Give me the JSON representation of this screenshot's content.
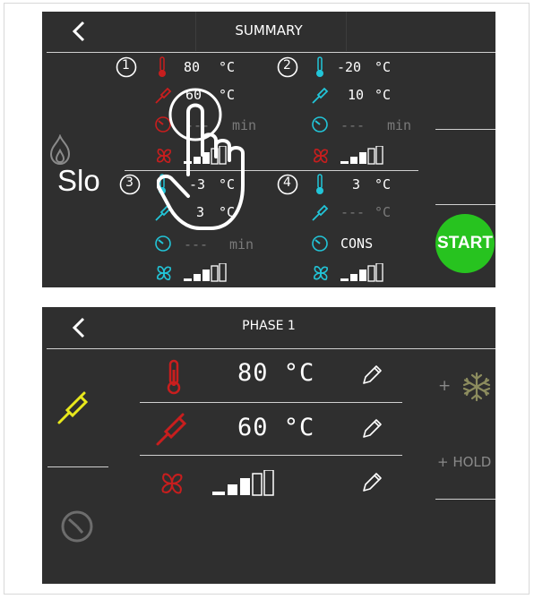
{
  "summary": {
    "title": "SUMMARY",
    "partial_text": "Slo",
    "start_label": "START",
    "phases": [
      {
        "num": "1",
        "temp": "80",
        "temp_unit": "°C",
        "probe": "60",
        "probe_unit": "°C",
        "time": "---",
        "time_unit": "min"
      },
      {
        "num": "2",
        "temp": "-20",
        "temp_unit": "°C",
        "probe": "10",
        "probe_unit": "°C",
        "time": "---",
        "time_unit": "min"
      },
      {
        "num": "3",
        "temp": "-3",
        "temp_unit": "°C",
        "probe": "3",
        "probe_unit": "°C",
        "time": "---",
        "time_unit": "min"
      },
      {
        "num": "4",
        "temp": "3",
        "temp_unit": "°C",
        "probe": "---",
        "probe_unit": "°C",
        "time": "CONS"
      }
    ],
    "overlay_icon": "tap-hand-icon"
  },
  "phase": {
    "title": "PHASE 1",
    "temp": "80 °C",
    "probe": "60 °C",
    "add_freeze": "+",
    "add_hold": "+ HOLD",
    "icons": [
      "thermometer-icon",
      "probe-icon",
      "fan-icon",
      "pencil-icon",
      "snowflake-icon",
      "timer-icon"
    ]
  },
  "colors": {
    "background": "#2f2f2f",
    "phase1_accent": "#c81e1e",
    "phase2_accent": "#22c5d8",
    "probe_selected": "#e8e81c",
    "start_button": "#27c31f",
    "inactive": "#7a7a7a"
  }
}
